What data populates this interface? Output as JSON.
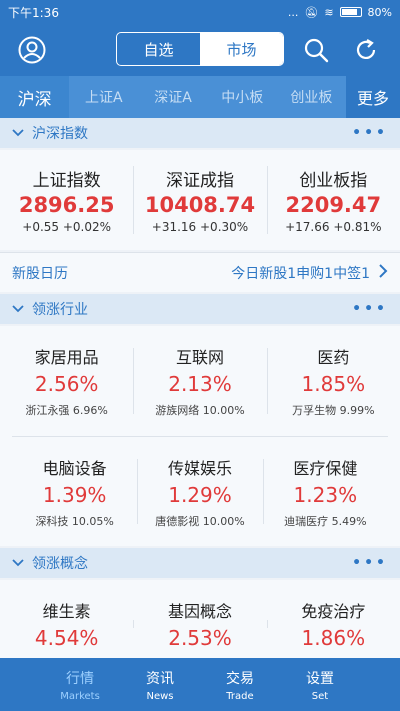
{
  "status_bar": {
    "time": "下午1:36",
    "signal_text": "...",
    "battery": "80%"
  },
  "header": {
    "segments": [
      {
        "label": "自选",
        "active": false
      },
      {
        "label": "市场",
        "active": true
      }
    ]
  },
  "tabs": [
    {
      "label": "沪深",
      "active": true
    },
    {
      "label": "上证A"
    },
    {
      "label": "深证A"
    },
    {
      "label": "中小板"
    },
    {
      "label": "创业板"
    },
    {
      "label": "更多"
    }
  ],
  "indices_section": {
    "title": "沪深指数",
    "more": "•••"
  },
  "indices": [
    {
      "name": "上证指数",
      "value": "2896.25",
      "change": "+0.55 +0.02%"
    },
    {
      "name": "深证成指",
      "value": "10408.74",
      "change": "+31.16 +0.30%"
    },
    {
      "name": "创业板指",
      "value": "2209.47",
      "change": "+17.66 +0.81%"
    }
  ],
  "ipo": {
    "left": "新股日历",
    "right": "今日新股1申购1中签1"
  },
  "industry_section": {
    "title": "领涨行业",
    "more": "•••"
  },
  "industries": [
    {
      "name": "家居用品",
      "pct": "2.56%",
      "sub": "浙江永强 6.96%"
    },
    {
      "name": "互联网",
      "pct": "2.13%",
      "sub": "游族网络 10.00%"
    },
    {
      "name": "医药",
      "pct": "1.85%",
      "sub": "万孚生物 9.99%"
    },
    {
      "name": "电脑设备",
      "pct": "1.39%",
      "sub": "深科技 10.05%"
    },
    {
      "name": "传媒娱乐",
      "pct": "1.29%",
      "sub": "唐德影视 10.00%"
    },
    {
      "name": "医疗保健",
      "pct": "1.23%",
      "sub": "迪瑞医疗 5.49%"
    }
  ],
  "concept_section": {
    "title": "领涨概念",
    "more": "•••"
  },
  "concepts": [
    {
      "name": "维生素",
      "pct": "4.54%"
    },
    {
      "name": "基因概念",
      "pct": "2.53%"
    },
    {
      "name": "免疫治疗",
      "pct": "1.86%"
    }
  ],
  "bottom_nav": [
    {
      "label": "行情",
      "sub": "Markets",
      "active": true
    },
    {
      "label": "资讯",
      "sub": "News"
    },
    {
      "label": "交易",
      "sub": "Trade"
    },
    {
      "label": "设置",
      "sub": "Set"
    }
  ]
}
